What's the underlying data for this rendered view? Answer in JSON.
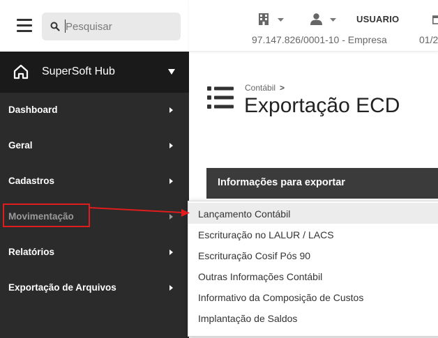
{
  "search": {
    "placeholder": "Pesquisar"
  },
  "header": {
    "username": "USUARIO",
    "company": "97.147.826/0001-10 - Empresa",
    "date": "01/2"
  },
  "sidebar": {
    "brand": "SuperSoft Hub",
    "items": [
      {
        "label": "Dashboard"
      },
      {
        "label": "Geral"
      },
      {
        "label": "Cadastros"
      },
      {
        "label": "Movimentação"
      },
      {
        "label": "Relatórios"
      },
      {
        "label": "Exportação de Arquivos"
      }
    ]
  },
  "main": {
    "breadcrumb": "Contábil",
    "breadcrumb_sep": ">",
    "title": "Exportação ECD",
    "section_title": "Informações para exportar"
  },
  "dropdown": {
    "items": [
      {
        "label": "Lançamento Contábil"
      },
      {
        "label": "Escrituração no LALUR / LACS"
      },
      {
        "label": "Escrituração Cosif Pós 90"
      },
      {
        "label": "Outras Informações Contábil"
      },
      {
        "label": "Informativo da Composição de Custos"
      },
      {
        "label": "Implantação de Saldos"
      }
    ]
  },
  "colors": {
    "sidebar_bg": "#2b2b2b",
    "brand_bg": "#1a1a1a",
    "section_bg": "#3b3b3b",
    "annotation": "#e21c1c"
  },
  "icons": {
    "menu": "hamburger-icon",
    "search": "search-icon",
    "company": "building-icon",
    "user": "user-icon",
    "calendar": "calendar-icon",
    "home": "home-icon",
    "page": "list-icon"
  }
}
